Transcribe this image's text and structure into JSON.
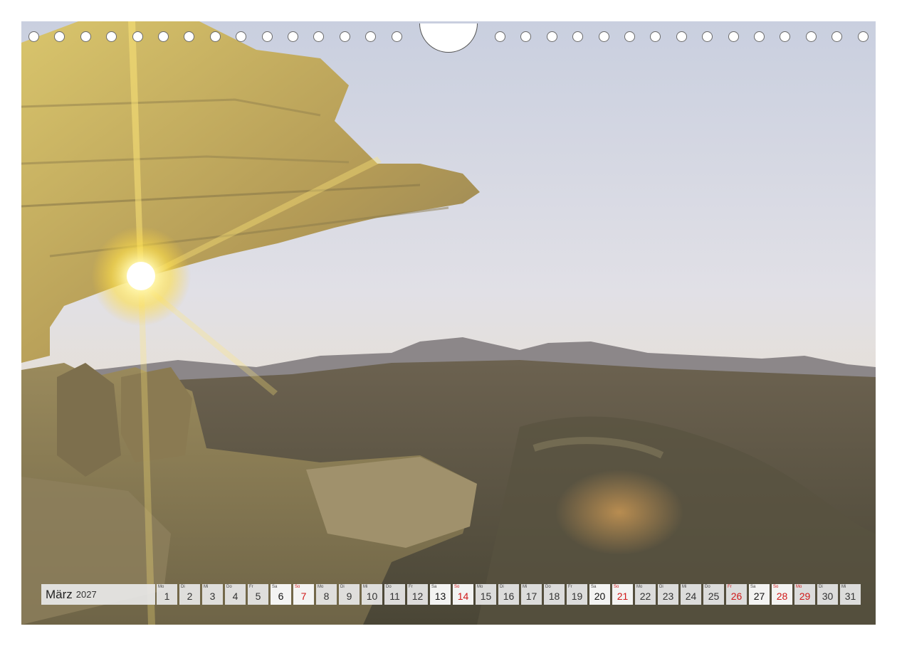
{
  "calendar": {
    "month": "März",
    "year": "2027",
    "days": [
      {
        "abbr": "Mo",
        "num": "1",
        "type": "weekday"
      },
      {
        "abbr": "Di",
        "num": "2",
        "type": "weekday"
      },
      {
        "abbr": "Mi",
        "num": "3",
        "type": "weekday"
      },
      {
        "abbr": "Do",
        "num": "4",
        "type": "weekday"
      },
      {
        "abbr": "Fr",
        "num": "5",
        "type": "weekday"
      },
      {
        "abbr": "Sa",
        "num": "6",
        "type": "sat"
      },
      {
        "abbr": "So",
        "num": "7",
        "type": "sun"
      },
      {
        "abbr": "Mo",
        "num": "8",
        "type": "weekday"
      },
      {
        "abbr": "Di",
        "num": "9",
        "type": "weekday"
      },
      {
        "abbr": "Mi",
        "num": "10",
        "type": "weekday"
      },
      {
        "abbr": "Do",
        "num": "11",
        "type": "weekday"
      },
      {
        "abbr": "Fr",
        "num": "12",
        "type": "weekday"
      },
      {
        "abbr": "Sa",
        "num": "13",
        "type": "sat"
      },
      {
        "abbr": "So",
        "num": "14",
        "type": "sun"
      },
      {
        "abbr": "Mo",
        "num": "15",
        "type": "weekday"
      },
      {
        "abbr": "Di",
        "num": "16",
        "type": "weekday"
      },
      {
        "abbr": "Mi",
        "num": "17",
        "type": "weekday"
      },
      {
        "abbr": "Do",
        "num": "18",
        "type": "weekday"
      },
      {
        "abbr": "Fr",
        "num": "19",
        "type": "weekday"
      },
      {
        "abbr": "Sa",
        "num": "20",
        "type": "sat"
      },
      {
        "abbr": "So",
        "num": "21",
        "type": "sun"
      },
      {
        "abbr": "Mo",
        "num": "22",
        "type": "weekday"
      },
      {
        "abbr": "Di",
        "num": "23",
        "type": "weekday"
      },
      {
        "abbr": "Mi",
        "num": "24",
        "type": "weekday"
      },
      {
        "abbr": "Do",
        "num": "25",
        "type": "weekday"
      },
      {
        "abbr": "Fr",
        "num": "26",
        "type": "hol"
      },
      {
        "abbr": "Sa",
        "num": "27",
        "type": "sat"
      },
      {
        "abbr": "So",
        "num": "28",
        "type": "sun"
      },
      {
        "abbr": "Mo",
        "num": "29",
        "type": "hol"
      },
      {
        "abbr": "Di",
        "num": "30",
        "type": "weekday"
      },
      {
        "abbr": "Mi",
        "num": "31",
        "type": "weekday"
      }
    ]
  },
  "colors": {
    "holiday_red": "#d01818",
    "sky_top": "#cfd5e3",
    "rock_gold": "#c2a454"
  }
}
